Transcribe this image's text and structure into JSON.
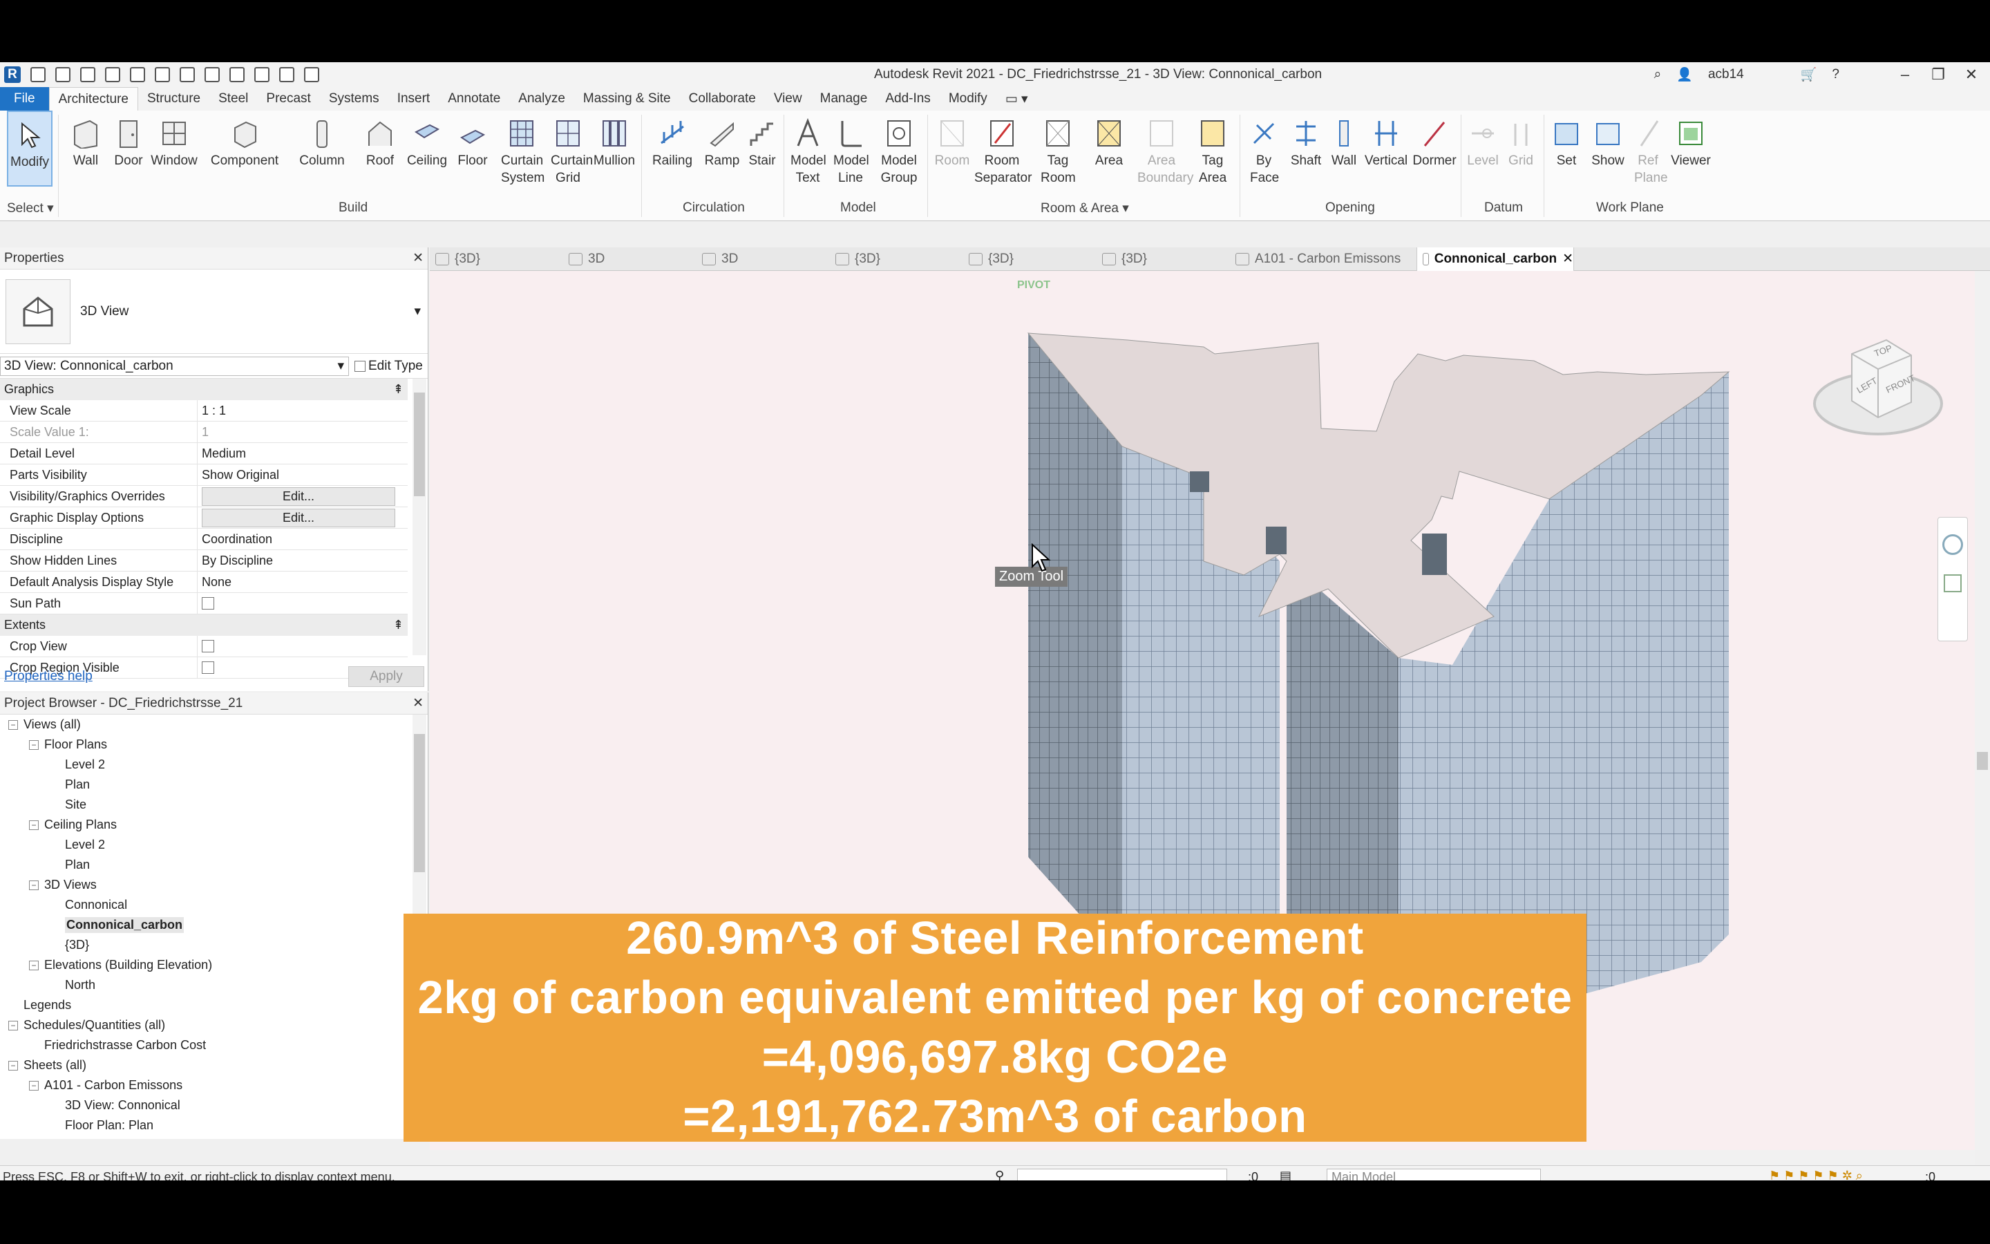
{
  "app": {
    "title": "Autodesk Revit 2021 - DC_Friedrichstrsse_21 - 3D View: Connonical_carbon",
    "user": "acb14"
  },
  "ribbon_tabs": [
    "File",
    "Architecture",
    "Structure",
    "Steel",
    "Precast",
    "Systems",
    "Insert",
    "Annotate",
    "Analyze",
    "Massing & Site",
    "Collaborate",
    "View",
    "Manage",
    "Add-Ins",
    "Modify"
  ],
  "ribbon": {
    "modify": "Modify",
    "select": "Select",
    "build": {
      "label": "Build",
      "tools": [
        "Wall",
        "Door",
        "Window",
        "Component",
        "Column",
        "Roof",
        "Ceiling",
        "Floor",
        "Curtain System",
        "Curtain Grid",
        "Mullion"
      ]
    },
    "circulation": {
      "label": "Circulation",
      "tools": [
        "Railing",
        "Ramp",
        "Stair"
      ]
    },
    "model": {
      "label": "Model",
      "tools": [
        "Model Text",
        "Model Line",
        "Model Group"
      ]
    },
    "room_area": {
      "label": "Room & Area",
      "tools": [
        "Room",
        "Room Separator",
        "Tag Room",
        "Area",
        "Area Boundary",
        "Tag Area"
      ]
    },
    "opening": {
      "label": "Opening",
      "tools": [
        "By Face",
        "Shaft",
        "Wall",
        "Vertical",
        "Dormer"
      ]
    },
    "datum": {
      "label": "Datum",
      "tools": [
        "Level",
        "Grid"
      ]
    },
    "work_plane": {
      "label": "Work Plane",
      "tools": [
        "Set",
        "Show",
        "Ref Plane",
        "Viewer"
      ]
    }
  },
  "properties": {
    "header": "Properties",
    "type": "3D View",
    "view_selector": "3D View: Connonical_carbon",
    "edit_type": "Edit Type",
    "group_graphics": "Graphics",
    "rows": [
      {
        "label": "View Scale",
        "value": "1 : 1"
      },
      {
        "label": "Scale Value    1:",
        "value": "1"
      },
      {
        "label": "Detail Level",
        "value": "Medium"
      },
      {
        "label": "Parts Visibility",
        "value": "Show Original"
      },
      {
        "label": "Visibility/Graphics Overrides",
        "value": "Edit..."
      },
      {
        "label": "Graphic Display Options",
        "value": "Edit..."
      },
      {
        "label": "Discipline",
        "value": "Coordination"
      },
      {
        "label": "Show Hidden Lines",
        "value": "By Discipline"
      },
      {
        "label": "Default Analysis Display Style",
        "value": "None"
      },
      {
        "label": "Sun Path",
        "value": ""
      }
    ],
    "group_extents": "Extents",
    "extent_rows": [
      {
        "label": "Crop View",
        "value": ""
      },
      {
        "label": "Crop Region Visible",
        "value": ""
      }
    ],
    "help": "Properties help",
    "apply": "Apply"
  },
  "browser": {
    "header": "Project Browser - DC_Friedrichstrsse_21",
    "nodes": [
      {
        "text": "Views (all)",
        "level": 0,
        "toggle": "−"
      },
      {
        "text": "Floor Plans",
        "level": 1,
        "toggle": "−"
      },
      {
        "text": "Level 2",
        "level": 2
      },
      {
        "text": "Plan",
        "level": 2
      },
      {
        "text": "Site",
        "level": 2
      },
      {
        "text": "Ceiling Plans",
        "level": 1,
        "toggle": "−"
      },
      {
        "text": "Level 2",
        "level": 2
      },
      {
        "text": "Plan",
        "level": 2
      },
      {
        "text": "3D Views",
        "level": 1,
        "toggle": "−"
      },
      {
        "text": "Connonical",
        "level": 2
      },
      {
        "text": "Connonical_carbon",
        "level": 2,
        "selected": true
      },
      {
        "text": "{3D}",
        "level": 2
      },
      {
        "text": "Elevations (Building Elevation)",
        "level": 1,
        "toggle": "−"
      },
      {
        "text": "North",
        "level": 2
      },
      {
        "text": "Legends",
        "level": 0
      },
      {
        "text": "Schedules/Quantities (all)",
        "level": 0,
        "toggle": "−"
      },
      {
        "text": "Friedrichstrasse Carbon Cost",
        "level": 1
      },
      {
        "text": "Sheets (all)",
        "level": 0,
        "toggle": "−"
      },
      {
        "text": "A101 - Carbon Emissons",
        "level": 1,
        "toggle": "−"
      },
      {
        "text": "3D View: Connonical",
        "level": 2
      },
      {
        "text": "Floor Plan: Plan",
        "level": 2
      }
    ]
  },
  "view_tabs": [
    "{3D}",
    "3D",
    "3D",
    "{3D}",
    "{3D}",
    "{3D}",
    "A101 - Carbon Emissons",
    "Connonical_carbon"
  ],
  "canvas": {
    "pivot": "PIVOT",
    "tooltip": "Zoom Tool",
    "viewcube": {
      "top": "TOP",
      "left": "LEFT",
      "front": "FRONT"
    }
  },
  "status": {
    "message": "Press ESC, F8 or Shift+W to exit, or right-click to display context menu.",
    "count": ":0",
    "model": "Main Model",
    "filter": ":0"
  },
  "caption": {
    "line1": "260.9m^3 of Steel Reinforcement",
    "line2": "2kg of carbon equivalent emitted per kg of concrete",
    "line3": "=4,096,697.8kg CO2e",
    "line4": "=2,191,762.73m^3 of carbon"
  },
  "colors": {
    "accent": "#1f73c6",
    "caption_bg": "#f0a43c",
    "canvas_bg": "#f9eef0"
  }
}
